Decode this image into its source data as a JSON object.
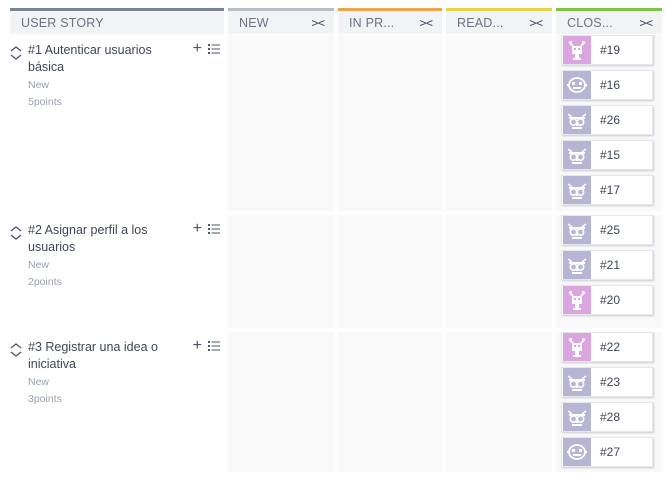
{
  "columns": [
    {
      "id": "us",
      "label": "USER STORY"
    },
    {
      "id": "new",
      "label": "NEW",
      "fold": "><"
    },
    {
      "id": "inp",
      "label": "IN PR...",
      "fold": "><"
    },
    {
      "id": "rdy",
      "label": "READ...",
      "fold": "><"
    },
    {
      "id": "cls",
      "label": "CLOS...",
      "fold": "><"
    }
  ],
  "colors": {
    "in_progress": "#f0a24c",
    "ready": "#e8d44a",
    "closed": "#83c34b",
    "avatar_pink": "#dba6df",
    "avatar_purple": "#b7b4d4"
  },
  "stories": [
    {
      "title": "#1 Autenticar usuarios básica",
      "status": "New",
      "points": "5points",
      "tasks": [
        {
          "ref": "#19",
          "avatar": "pink-monster-icon"
        },
        {
          "ref": "#16",
          "avatar": "purple-face-icon"
        },
        {
          "ref": "#26",
          "avatar": "purple-owl-icon"
        },
        {
          "ref": "#15",
          "avatar": "purple-owl-icon"
        },
        {
          "ref": "#17",
          "avatar": "purple-owl-icon"
        }
      ]
    },
    {
      "title": "#2 Asignar perfil a los usuarios",
      "status": "New",
      "points": "2points",
      "tasks": [
        {
          "ref": "#25",
          "avatar": "purple-owl-icon"
        },
        {
          "ref": "#21",
          "avatar": "purple-owl-icon"
        },
        {
          "ref": "#20",
          "avatar": "pink-monster-icon"
        }
      ]
    },
    {
      "title": "#3 Registrar una idea o iniciativa",
      "status": "New",
      "points": "3points",
      "tasks": [
        {
          "ref": "#22",
          "avatar": "pink-monster-icon"
        },
        {
          "ref": "#23",
          "avatar": "purple-owl-icon"
        },
        {
          "ref": "#28",
          "avatar": "purple-owl-icon"
        },
        {
          "ref": "#27",
          "avatar": "purple-face-icon"
        }
      ]
    }
  ]
}
